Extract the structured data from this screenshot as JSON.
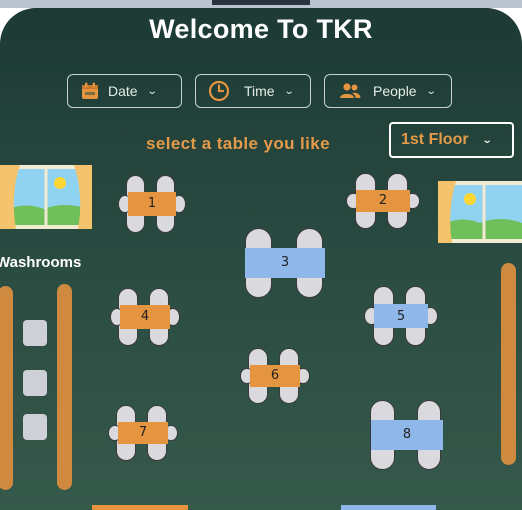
{
  "header": {
    "title": "Welcome To TKR"
  },
  "filters": {
    "date_label": "Date",
    "time_label": "Time",
    "people_label": "People"
  },
  "prompt": "select a table you like",
  "floor": {
    "selected": "1st Floor"
  },
  "washrooms_label": "Washrooms",
  "tables": [
    {
      "label": "1",
      "status": "available"
    },
    {
      "label": "2",
      "status": "available"
    },
    {
      "label": "3",
      "status": "selected"
    },
    {
      "label": "4",
      "status": "available"
    },
    {
      "label": "5",
      "status": "selected"
    },
    {
      "label": "6",
      "status": "available"
    },
    {
      "label": "7",
      "status": "available"
    },
    {
      "label": "8",
      "status": "selected"
    }
  ],
  "colors": {
    "available": "#e5943f",
    "selected": "#8fb7ea",
    "accent": "#e49a4b",
    "background_top": "#1d3a35",
    "background_bottom": "#35594b"
  },
  "icons": {
    "date": "calendar-icon",
    "time": "clock-icon",
    "people": "people-icon",
    "chevron": "chevron-down-icon"
  }
}
